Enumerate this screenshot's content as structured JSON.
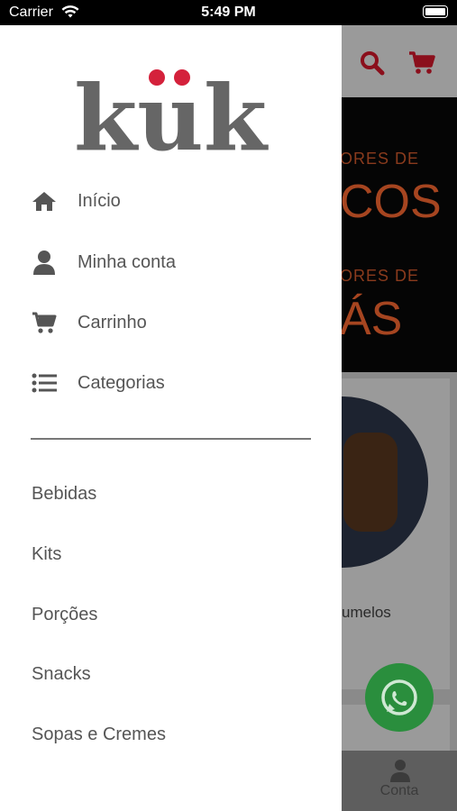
{
  "status": {
    "carrier": "Carrier",
    "time": "5:49 PM"
  },
  "logo_text": "kük",
  "menu": [
    {
      "label": "Início",
      "icon": "home-icon"
    },
    {
      "label": "Minha conta",
      "icon": "user-icon"
    },
    {
      "label": "Carrinho",
      "icon": "cart-icon"
    },
    {
      "label": "Categorias",
      "icon": "list-icon"
    }
  ],
  "categories": [
    "Bebidas",
    "Kits",
    "Porções",
    "Snacks",
    "Sopas e Cremes"
  ],
  "background": {
    "banner_line1": "ORES DE",
    "banner_line2": "COS",
    "banner_line3": "ORES DE",
    "banner_line4": "ÁS",
    "product_name": "umelos",
    "tab_label": "Conta"
  },
  "colors": {
    "brand_red": "#d4213b",
    "logo_grey": "#666666",
    "text": "#555555"
  }
}
